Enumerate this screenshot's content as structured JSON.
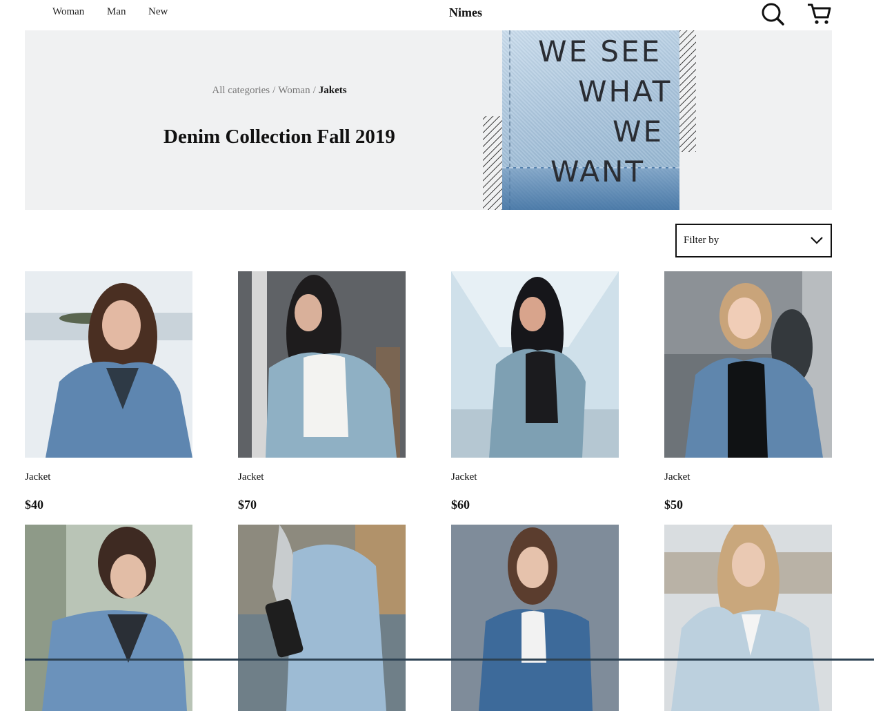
{
  "nav": {
    "links": [
      "Woman",
      "Man",
      "New"
    ],
    "brand": "Nimes",
    "icons": [
      "search-icon",
      "cart-icon"
    ]
  },
  "hero": {
    "breadcrumb": [
      "All categories",
      "Woman",
      "Jakets"
    ],
    "title": "Denim Collection Fall 2019",
    "image_text": [
      "WE SEE",
      "WHAT",
      "WE",
      "WANT"
    ]
  },
  "filter": {
    "label": "Filter by",
    "icon": "chevron-down-icon"
  },
  "products": [
    {
      "name": "Jacket",
      "price": "$40"
    },
    {
      "name": "Jacket",
      "price": "$70"
    },
    {
      "name": "Jacket",
      "price": "$60"
    },
    {
      "name": "Jacket",
      "price": "$50"
    },
    {
      "name": "",
      "price": ""
    },
    {
      "name": "",
      "price": ""
    },
    {
      "name": "",
      "price": ""
    },
    {
      "name": "",
      "price": ""
    }
  ],
  "colors": {
    "hero_bg": "#f0f1f2",
    "text": "#111111",
    "muted": "#777777",
    "denim": "#8aaecb",
    "bottom_bar": "#2d4253"
  }
}
